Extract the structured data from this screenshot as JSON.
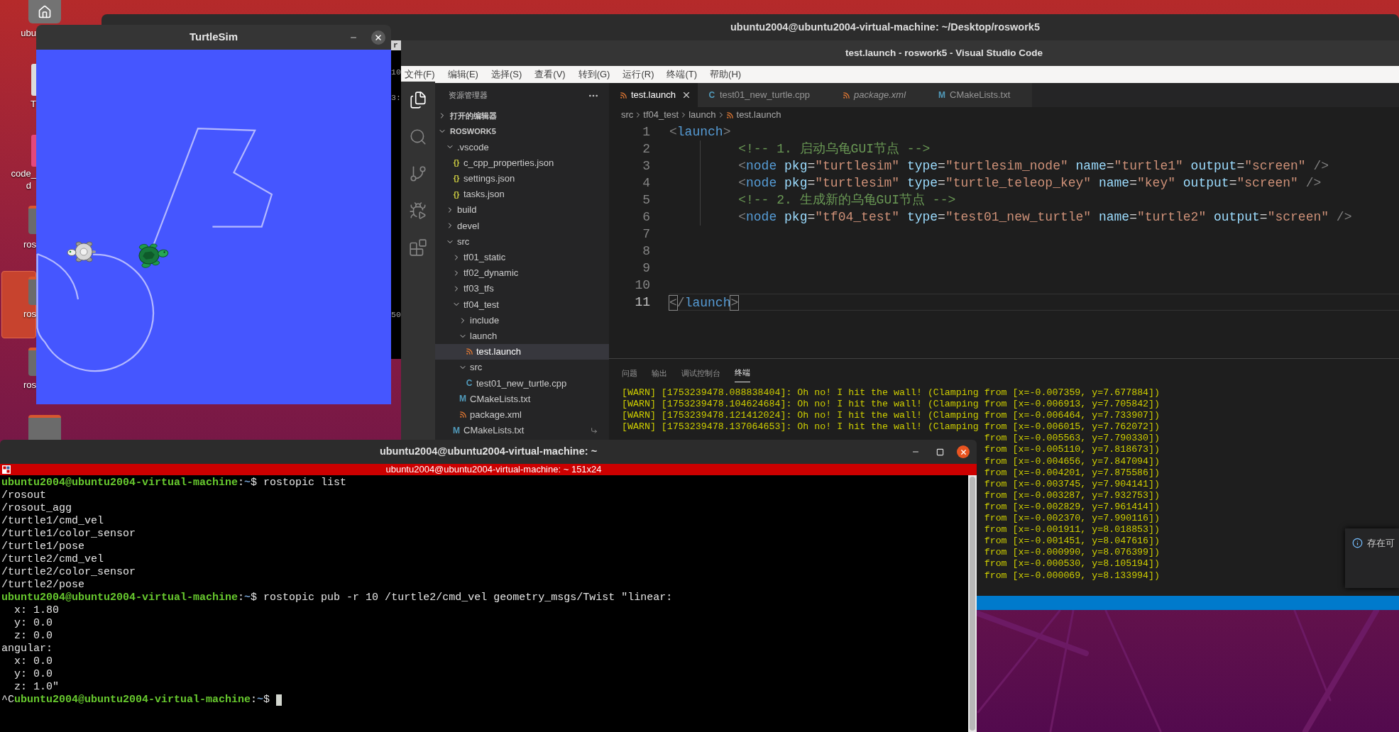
{
  "desktop": {
    "icons": [
      {
        "kind": "home",
        "label_lines": [
          "ubu"
        ],
        "selected": false
      },
      {
        "kind": "document",
        "label_lines": [
          "T"
        ],
        "selected": false
      },
      {
        "kind": "app",
        "label_lines": [
          "code_",
          "d"
        ],
        "selected": false
      },
      {
        "kind": "folder",
        "label_lines": [
          "ros"
        ],
        "selected": false
      },
      {
        "kind": "folder",
        "label_lines": [
          "ros"
        ],
        "selected": true
      },
      {
        "kind": "folder",
        "label_lines": [
          "ros"
        ],
        "selected": false
      },
      {
        "kind": "folder",
        "selected": false
      }
    ]
  },
  "background_terminal": {
    "title": "ubuntu2004@ubuntu2004-virtual-machine: ~/Desktop/roswork5",
    "tab_fragment": "r",
    "fragments": [
      "10",
      "3:",
      "50"
    ]
  },
  "turtlesim": {
    "title": "TurtleSim"
  },
  "vscode": {
    "title": "test.launch - roswork5 - Visual Studio Code",
    "menu": [
      "文件(F)",
      "编辑(E)",
      "选择(S)",
      "查看(V)",
      "转到(G)",
      "运行(R)",
      "终端(T)",
      "帮助(H)"
    ],
    "activity_bar": [
      {
        "kind": "explorer",
        "selected": true
      },
      {
        "kind": "search",
        "selected": false
      },
      {
        "kind": "source_control",
        "selected": false
      },
      {
        "kind": "run_debug",
        "selected": false
      },
      {
        "kind": "extensions",
        "selected": false
      }
    ],
    "explorer": {
      "title": "资源管理器",
      "sections": [
        {
          "label": "打开的编辑器",
          "expanded": false
        },
        {
          "label": "ROSWORK5",
          "expanded": true,
          "items": [
            {
              "label": ".vscode",
              "kind": "folder",
              "expanded": true,
              "selected": false,
              "symlink": false,
              "children": [
                {
                  "label": "c_cpp_properties.json",
                  "kind": "json",
                  "icon_text": "{}",
                  "selected": false,
                  "symlink": false
                },
                {
                  "label": "settings.json",
                  "kind": "json",
                  "icon_text": "{}",
                  "selected": false,
                  "symlink": false
                },
                {
                  "label": "tasks.json",
                  "kind": "json",
                  "icon_text": "{}",
                  "selected": false,
                  "symlink": false
                }
              ]
            },
            {
              "label": "build",
              "kind": "folder",
              "expanded": false,
              "selected": false,
              "symlink": false
            },
            {
              "label": "devel",
              "kind": "folder",
              "expanded": false,
              "selected": false,
              "symlink": false
            },
            {
              "label": "src",
              "kind": "folder",
              "expanded": true,
              "selected": false,
              "symlink": false,
              "children": [
                {
                  "label": "tf01_static",
                  "kind": "folder",
                  "expanded": false,
                  "selected": false,
                  "symlink": false
                },
                {
                  "label": "tf02_dynamic",
                  "kind": "folder",
                  "expanded": false,
                  "selected": false,
                  "symlink": false
                },
                {
                  "label": "tf03_tfs",
                  "kind": "folder",
                  "expanded": false,
                  "selected": false,
                  "symlink": false
                },
                {
                  "label": "tf04_test",
                  "kind": "folder",
                  "expanded": true,
                  "selected": false,
                  "symlink": false,
                  "children": [
                    {
                      "label": "include",
                      "kind": "folder",
                      "expanded": false,
                      "selected": false,
                      "symlink": false
                    },
                    {
                      "label": "launch",
                      "kind": "folder",
                      "expanded": true,
                      "selected": false,
                      "symlink": false,
                      "children": [
                        {
                          "label": "test.launch",
                          "kind": "launch",
                          "selected": true,
                          "symlink": false
                        }
                      ]
                    },
                    {
                      "label": "src",
                      "kind": "folder",
                      "expanded": true,
                      "selected": false,
                      "symlink": false,
                      "children": [
                        {
                          "label": "test01_new_turtle.cpp",
                          "kind": "cpp",
                          "icon_text": "C",
                          "selected": false,
                          "symlink": false
                        }
                      ]
                    },
                    {
                      "label": "CMakeLists.txt",
                      "kind": "cmake",
                      "icon_text": "M",
                      "selected": false,
                      "symlink": false
                    },
                    {
                      "label": "package.xml",
                      "kind": "xml",
                      "selected": false,
                      "symlink": false
                    }
                  ]
                },
                {
                  "label": "CMakeLists.txt",
                  "kind": "cmake",
                  "icon_text": "M",
                  "selected": false,
                  "symlink": true
                }
              ]
            }
          ]
        }
      ]
    },
    "tabs": [
      {
        "label": "test.launch",
        "kind": "launch",
        "selected": true,
        "preview": false
      },
      {
        "label": "test01_new_turtle.cpp",
        "kind": "cpp",
        "icon_text": "C",
        "selected": false,
        "preview": false
      },
      {
        "label": "package.xml",
        "kind": "xml",
        "selected": false,
        "preview": true
      },
      {
        "label": "CMakeLists.txt",
        "kind": "cmake",
        "icon_text": "M",
        "selected": false,
        "preview": false
      }
    ],
    "breadcrumb": [
      {
        "label": "src",
        "kind": "folder"
      },
      {
        "label": "tf04_test",
        "kind": "folder"
      },
      {
        "label": "launch",
        "kind": "folder"
      },
      {
        "label": "test.launch",
        "kind": "launch"
      }
    ],
    "editor": {
      "lines": [
        {
          "number": "1",
          "indented": false,
          "current": false,
          "tokens": [
            {
              "kind": "bracket",
              "text": "<"
            },
            {
              "kind": "tag",
              "text": "launch"
            },
            {
              "kind": "bracket",
              "text": ">"
            }
          ]
        },
        {
          "number": "2",
          "indented": true,
          "current": false,
          "tokens": [
            {
              "kind": "comment",
              "text": "<!-- 1. 启动乌龟GUI节点 -->"
            }
          ]
        },
        {
          "number": "3",
          "indented": true,
          "current": false,
          "tokens": [
            {
              "kind": "bracket",
              "text": "<"
            },
            {
              "kind": "tag",
              "text": "node"
            },
            {
              "kind": "attr",
              "text": " pkg"
            },
            {
              "kind": "punct",
              "text": "="
            },
            {
              "kind": "string",
              "text": "\"turtlesim\""
            },
            {
              "kind": "attr",
              "text": " type"
            },
            {
              "kind": "punct",
              "text": "="
            },
            {
              "kind": "string",
              "text": "\"turtlesim_node\""
            },
            {
              "kind": "attr",
              "text": " name"
            },
            {
              "kind": "punct",
              "text": "="
            },
            {
              "kind": "string",
              "text": "\"turtle1\""
            },
            {
              "kind": "attr",
              "text": " output"
            },
            {
              "kind": "punct",
              "text": "="
            },
            {
              "kind": "string",
              "text": "\"screen\""
            },
            {
              "kind": "bracket",
              "text": " />"
            }
          ]
        },
        {
          "number": "4",
          "indented": true,
          "current": false,
          "tokens": [
            {
              "kind": "bracket",
              "text": "<"
            },
            {
              "kind": "tag",
              "text": "node"
            },
            {
              "kind": "attr",
              "text": " pkg"
            },
            {
              "kind": "punct",
              "text": "="
            },
            {
              "kind": "string",
              "text": "\"turtlesim\""
            },
            {
              "kind": "attr",
              "text": " type"
            },
            {
              "kind": "punct",
              "text": "="
            },
            {
              "kind": "string",
              "text": "\"turtle_teleop_key\""
            },
            {
              "kind": "attr",
              "text": " name"
            },
            {
              "kind": "punct",
              "text": "="
            },
            {
              "kind": "string",
              "text": "\"key\""
            },
            {
              "kind": "attr",
              "text": " output"
            },
            {
              "kind": "punct",
              "text": "="
            },
            {
              "kind": "string",
              "text": "\"screen\""
            },
            {
              "kind": "bracket",
              "text": " />"
            }
          ]
        },
        {
          "number": "5",
          "indented": true,
          "current": false,
          "tokens": [
            {
              "kind": "comment",
              "text": "<!-- 2. 生成新的乌龟GUI节点 -->"
            }
          ]
        },
        {
          "number": "6",
          "indented": true,
          "current": false,
          "tokens": [
            {
              "kind": "bracket",
              "text": "<"
            },
            {
              "kind": "tag",
              "text": "node"
            },
            {
              "kind": "attr",
              "text": " pkg"
            },
            {
              "kind": "punct",
              "text": "="
            },
            {
              "kind": "string",
              "text": "\"tf04_test\""
            },
            {
              "kind": "attr",
              "text": " type"
            },
            {
              "kind": "punct",
              "text": "="
            },
            {
              "kind": "string",
              "text": "\"test01_new_turtle\""
            },
            {
              "kind": "attr",
              "text": " name"
            },
            {
              "kind": "punct",
              "text": "="
            },
            {
              "kind": "string",
              "text": "\"turtle2\""
            },
            {
              "kind": "attr",
              "text": " output"
            },
            {
              "kind": "punct",
              "text": "="
            },
            {
              "kind": "string",
              "text": "\"screen\""
            },
            {
              "kind": "bracket",
              "text": " />"
            }
          ]
        },
        {
          "number": "7",
          "indented": false,
          "current": false
        },
        {
          "number": "8",
          "indented": false,
          "current": false
        },
        {
          "number": "9",
          "indented": false,
          "current": false
        },
        {
          "number": "10",
          "indented": false,
          "current": false
        },
        {
          "number": "11",
          "indented": false,
          "current": true,
          "tokens": [
            {
              "kind": "bracket",
              "text": "<",
              "matched": true
            },
            {
              "kind": "bracket",
              "text": "/",
              "matched": false
            },
            {
              "kind": "tag",
              "text": "launch",
              "matched": false
            },
            {
              "kind": "bracket",
              "text": ">",
              "matched": true
            }
          ]
        }
      ]
    },
    "panel": {
      "tabs": [
        {
          "label": "问题",
          "selected": false
        },
        {
          "label": "输出",
          "selected": false
        },
        {
          "label": "调试控制台",
          "selected": false
        },
        {
          "label": "终端",
          "selected": true
        }
      ],
      "lines": [
        {
          "text": "[WARN] [1753239478.088838404]: Oh no! I hit the wall! (Clamping from [x=-0.007359, y=7.677884])",
          "partial": false
        },
        {
          "text": "[WARN] [1753239478.104624684]: Oh no! I hit the wall! (Clamping from [x=-0.006913, y=7.705842])",
          "partial": false
        },
        {
          "text": "[WARN] [1753239478.121412024]: Oh no! I hit the wall! (Clamping from [x=-0.006464, y=7.733907])",
          "partial": false
        },
        {
          "text": "[WARN] [1753239478.137064653]: Oh no! I hit the wall! (Clamping from [x=-0.006015, y=7.762072])",
          "partial": false
        },
        {
          "text": "from [x=-0.005563, y=7.790330])",
          "partial": true
        },
        {
          "text": "from [x=-0.005110, y=7.818673])",
          "partial": true
        },
        {
          "text": "from [x=-0.004656, y=7.847094])",
          "partial": true
        },
        {
          "text": "from [x=-0.004201, y=7.875586])",
          "partial": true
        },
        {
          "text": "from [x=-0.003745, y=7.904141])",
          "partial": true
        },
        {
          "text": "from [x=-0.003287, y=7.932753])",
          "partial": true
        },
        {
          "text": "from [x=-0.002829, y=7.961414])",
          "partial": true
        },
        {
          "text": "from [x=-0.002370, y=7.990116])",
          "partial": true
        },
        {
          "text": "from [x=-0.001911, y=8.018853])",
          "partial": true
        },
        {
          "text": "from [x=-0.001451, y=8.047616])",
          "partial": true
        },
        {
          "text": "from [x=-0.000990, y=8.076399])",
          "partial": true
        },
        {
          "text": "from [x=-0.000530, y=8.105194])",
          "partial": true
        },
        {
          "text": "from [x=-0.000069, y=8.133994])",
          "partial": true
        }
      ]
    },
    "notification": {
      "text": "存在可"
    }
  },
  "terminal": {
    "title": "ubuntu2004@ubuntu2004-virtual-machine: ~",
    "tab_title": "ubuntu2004@ubuntu2004-virtual-machine: ~ 151x24",
    "lines": [
      {
        "cursor": false,
        "segments": [
          {
            "kind": "user",
            "text": "ubuntu2004@ubuntu2004-virtual-machine"
          },
          {
            "kind": "plain",
            "text": ":"
          },
          {
            "kind": "path",
            "text": "~"
          },
          {
            "kind": "plain",
            "text": "$ rostopic list"
          }
        ]
      },
      {
        "cursor": false,
        "segments": [
          {
            "kind": "plain",
            "text": "/rosout"
          }
        ]
      },
      {
        "cursor": false,
        "segments": [
          {
            "kind": "plain",
            "text": "/rosout_agg"
          }
        ]
      },
      {
        "cursor": false,
        "segments": [
          {
            "kind": "plain",
            "text": "/turtle1/cmd_vel"
          }
        ]
      },
      {
        "cursor": false,
        "segments": [
          {
            "kind": "plain",
            "text": "/turtle1/color_sensor"
          }
        ]
      },
      {
        "cursor": false,
        "segments": [
          {
            "kind": "plain",
            "text": "/turtle1/pose"
          }
        ]
      },
      {
        "cursor": false,
        "segments": [
          {
            "kind": "plain",
            "text": "/turtle2/cmd_vel"
          }
        ]
      },
      {
        "cursor": false,
        "segments": [
          {
            "kind": "plain",
            "text": "/turtle2/color_sensor"
          }
        ]
      },
      {
        "cursor": false,
        "segments": [
          {
            "kind": "plain",
            "text": "/turtle2/pose"
          }
        ]
      },
      {
        "cursor": false,
        "segments": [
          {
            "kind": "user",
            "text": "ubuntu2004@ubuntu2004-virtual-machine"
          },
          {
            "kind": "plain",
            "text": ":"
          },
          {
            "kind": "path",
            "text": "~"
          },
          {
            "kind": "plain",
            "text": "$ rostopic pub -r 10 /turtle2/cmd_vel geometry_msgs/Twist \"linear:"
          }
        ]
      },
      {
        "cursor": false,
        "segments": [
          {
            "kind": "plain",
            "text": "  x: 1.80"
          }
        ]
      },
      {
        "cursor": false,
        "segments": [
          {
            "kind": "plain",
            "text": "  y: 0.0"
          }
        ]
      },
      {
        "cursor": false,
        "segments": [
          {
            "kind": "plain",
            "text": "  z: 0.0"
          }
        ]
      },
      {
        "cursor": false,
        "segments": [
          {
            "kind": "plain",
            "text": "angular:"
          }
        ]
      },
      {
        "cursor": false,
        "segments": [
          {
            "kind": "plain",
            "text": "  x: 0.0"
          }
        ]
      },
      {
        "cursor": false,
        "segments": [
          {
            "kind": "plain",
            "text": "  y: 0.0"
          }
        ]
      },
      {
        "cursor": false,
        "segments": [
          {
            "kind": "plain",
            "text": "  z: 1.0\""
          }
        ]
      },
      {
        "cursor": true,
        "segments": [
          {
            "kind": "plain",
            "text": "^C"
          },
          {
            "kind": "user",
            "text": "ubuntu2004@ubuntu2004-virtual-machine"
          },
          {
            "kind": "plain",
            "text": ":"
          },
          {
            "kind": "path",
            "text": "~"
          },
          {
            "kind": "plain",
            "text": "$ "
          }
        ]
      }
    ]
  }
}
